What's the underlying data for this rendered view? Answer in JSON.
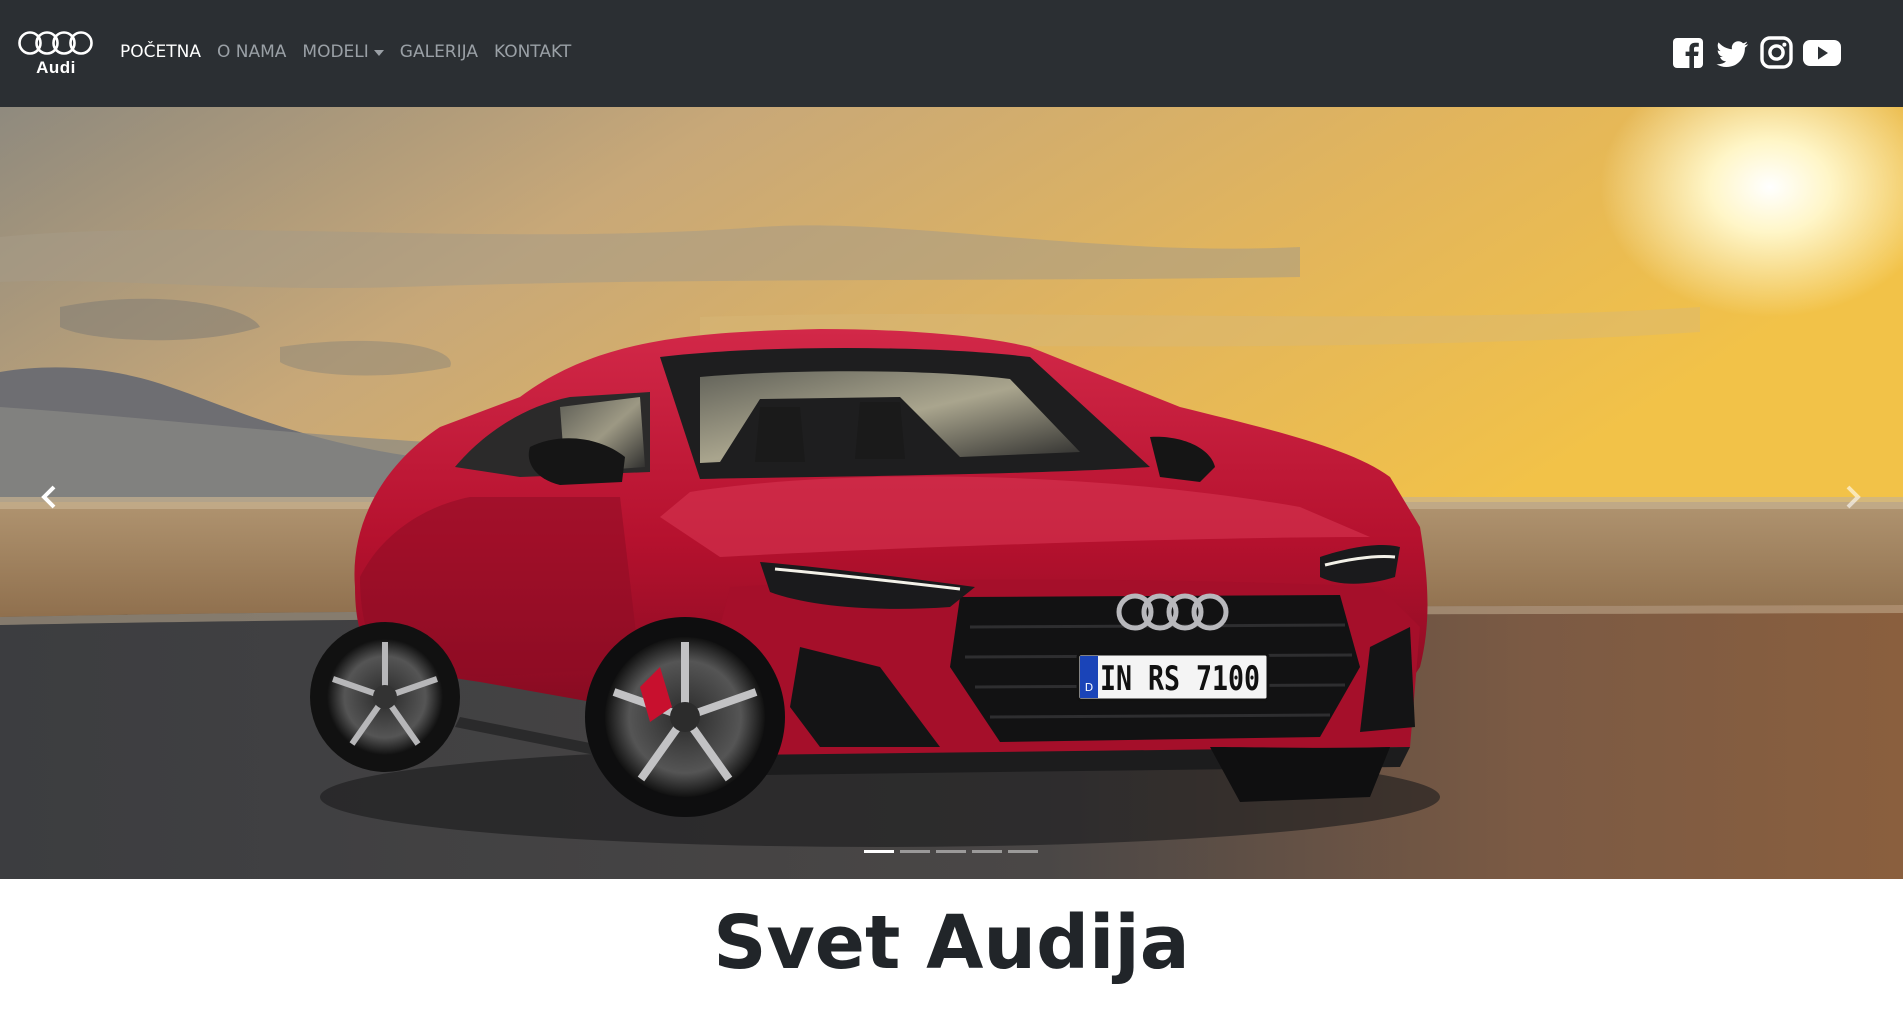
{
  "navbar": {
    "brand": {
      "logo_icon": "audi-rings-icon",
      "text": "Audi"
    },
    "links": [
      {
        "label": "POČETNA",
        "active": true
      },
      {
        "label": "O NAMA",
        "active": false
      },
      {
        "label": "MODELI",
        "active": false,
        "dropdown": true
      },
      {
        "label": "GALERIJA",
        "active": false
      },
      {
        "label": "KONTAKT",
        "active": false
      }
    ],
    "social": [
      "facebook-icon",
      "twitter-icon",
      "instagram-icon",
      "youtube-icon"
    ]
  },
  "carousel": {
    "slide_image": "red-audi-rs7-sportback-sunset",
    "license_plate": "IN RS 7100",
    "plate_country": "D",
    "slide_count": 5,
    "active_slide": 1,
    "prev_icon": "chevron-left-icon",
    "next_icon": "chevron-right-icon"
  },
  "main": {
    "title": "Svet Audija"
  },
  "colors": {
    "navbar_bg": "#2b2f33",
    "car_red": "#b0102c",
    "title": "#212529"
  }
}
